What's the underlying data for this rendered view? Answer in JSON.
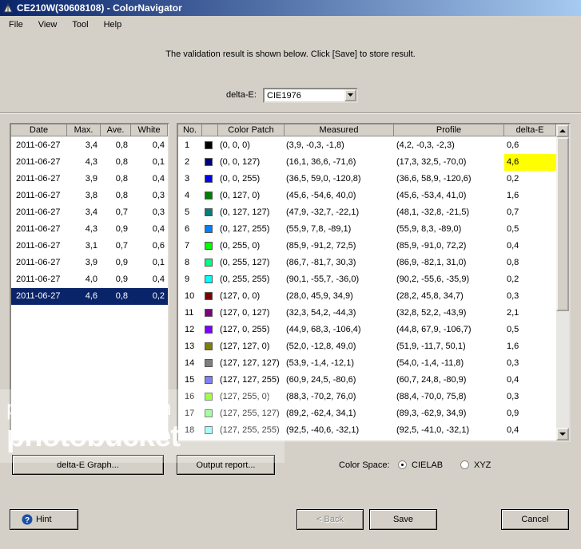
{
  "window": {
    "title": "CE210W(30608108) - ColorNavigator"
  },
  "menu": [
    "File",
    "View",
    "Tool",
    "Help"
  ],
  "message": "The validation result is shown below.  Click [Save] to store result.",
  "deltaE": {
    "label": "delta-E:",
    "value": "CIE1976"
  },
  "left_table": {
    "headers": [
      "Date",
      "Max.",
      "Ave.",
      "White"
    ],
    "rows": [
      [
        "2011-06-27",
        "3,4",
        "0,8",
        "0,4"
      ],
      [
        "2011-06-27",
        "4,3",
        "0,8",
        "0,1"
      ],
      [
        "2011-06-27",
        "3,9",
        "0,8",
        "0,4"
      ],
      [
        "2011-06-27",
        "3,8",
        "0,8",
        "0,3"
      ],
      [
        "2011-06-27",
        "3,4",
        "0,7",
        "0,3"
      ],
      [
        "2011-06-27",
        "4,3",
        "0,9",
        "0,4"
      ],
      [
        "2011-06-27",
        "3,1",
        "0,7",
        "0,6"
      ],
      [
        "2011-06-27",
        "3,9",
        "0,9",
        "0,1"
      ],
      [
        "2011-06-27",
        "4,0",
        "0,9",
        "0,4"
      ],
      [
        "2011-06-27",
        "4,6",
        "0,8",
        "0,2"
      ]
    ],
    "selected_index": 9
  },
  "right_table": {
    "headers": [
      "No.",
      "",
      "Color Patch",
      "Measured",
      "Profile",
      "delta-E"
    ],
    "rows": [
      {
        "no": "1",
        "color": "#000000",
        "patch": "(0, 0, 0)",
        "measured": "(3,9, -0,3, -1,8)",
        "profile": "(4,2, -0,3, -2,3)",
        "de": "0,6"
      },
      {
        "no": "2",
        "color": "#00007f",
        "patch": "(0, 0, 127)",
        "measured": "(16,1, 36,6, -71,6)",
        "profile": "(17,3, 32,5, -70,0)",
        "de": "4,6",
        "highlight": true
      },
      {
        "no": "3",
        "color": "#0000ff",
        "patch": "(0, 0, 255)",
        "measured": "(36,5, 59,0, -120,8)",
        "profile": "(36,6, 58,9, -120,6)",
        "de": "0,2"
      },
      {
        "no": "4",
        "color": "#007f00",
        "patch": "(0, 127, 0)",
        "measured": "(45,6, -54,6, 40,0)",
        "profile": "(45,6, -53,4, 41,0)",
        "de": "1,6"
      },
      {
        "no": "5",
        "color": "#007f7f",
        "patch": "(0, 127, 127)",
        "measured": "(47,9, -32,7, -22,1)",
        "profile": "(48,1, -32,8, -21,5)",
        "de": "0,7"
      },
      {
        "no": "6",
        "color": "#007fff",
        "patch": "(0, 127, 255)",
        "measured": "(55,9, 7,8, -89,1)",
        "profile": "(55,9, 8,3, -89,0)",
        "de": "0,5"
      },
      {
        "no": "7",
        "color": "#00ff00",
        "patch": "(0, 255, 0)",
        "measured": "(85,9, -91,2, 72,5)",
        "profile": "(85,9, -91,0, 72,2)",
        "de": "0,4"
      },
      {
        "no": "8",
        "color": "#00ff7f",
        "patch": "(0, 255, 127)",
        "measured": "(86,7, -81,7, 30,3)",
        "profile": "(86,9, -82,1, 31,0)",
        "de": "0,8"
      },
      {
        "no": "9",
        "color": "#00ffff",
        "patch": "(0, 255, 255)",
        "measured": "(90,1, -55,7, -36,0)",
        "profile": "(90,2, -55,6, -35,9)",
        "de": "0,2"
      },
      {
        "no": "10",
        "color": "#7f0000",
        "patch": "(127, 0, 0)",
        "measured": "(28,0, 45,9, 34,9)",
        "profile": "(28,2, 45,8, 34,7)",
        "de": "0,3"
      },
      {
        "no": "11",
        "color": "#7f007f",
        "patch": "(127, 0, 127)",
        "measured": "(32,3, 54,2, -44,3)",
        "profile": "(32,8, 52,2, -43,9)",
        "de": "2,1"
      },
      {
        "no": "12",
        "color": "#7f00ff",
        "patch": "(127, 0, 255)",
        "measured": "(44,9, 68,3, -106,4)",
        "profile": "(44,8, 67,9, -106,7)",
        "de": "0,5"
      },
      {
        "no": "13",
        "color": "#7f7f00",
        "patch": "(127, 127, 0)",
        "measured": "(52,0, -12,8, 49,0)",
        "profile": "(51,9, -11,7, 50,1)",
        "de": "1,6"
      },
      {
        "no": "14",
        "color": "#7f7f7f",
        "patch": "(127, 127, 127)",
        "measured": "(53,9, -1,4, -12,1)",
        "profile": "(54,0, -1,4, -11,8)",
        "de": "0,3"
      },
      {
        "no": "15",
        "color": "#7f7fff",
        "patch": "(127, 127, 255)",
        "measured": "(60,9, 24,5, -80,6)",
        "profile": "(60,7, 24,8, -80,9)",
        "de": "0,4"
      },
      {
        "no": "16",
        "color": "#7fff00",
        "patch": "(127, 255, 0)",
        "measured": "(88,3, -70,2, 76,0)",
        "profile": "(88,4, -70,0, 75,8)",
        "de": "0,3"
      },
      {
        "no": "17",
        "color": "#7fff7f",
        "patch": "(127, 255, 127)",
        "measured": "(89,2, -62,4, 34,1)",
        "profile": "(89,3, -62,9, 34,9)",
        "de": "0,9"
      },
      {
        "no": "18",
        "color": "#7fffff",
        "patch": "(127, 255, 255)",
        "measured": "(92,5, -40,6, -32,1)",
        "profile": "(92,5, -41,0, -32,1)",
        "de": "0,4"
      }
    ]
  },
  "buttons": {
    "delta_e_graph": "delta-E Graph...",
    "output_report": "Output report...",
    "hint": "Hint",
    "back": "< Back",
    "save": "Save",
    "cancel": "Cancel"
  },
  "color_space": {
    "label": "Color Space:",
    "options": [
      "CIELAB",
      "XYZ"
    ],
    "selected": "CIELAB"
  },
  "watermark": {
    "line1": "proudly hosted on",
    "line2": "photobucket",
    "mark": "®"
  },
  "colors": {
    "selection": "#0a246a",
    "highlight": "#ffff00"
  }
}
